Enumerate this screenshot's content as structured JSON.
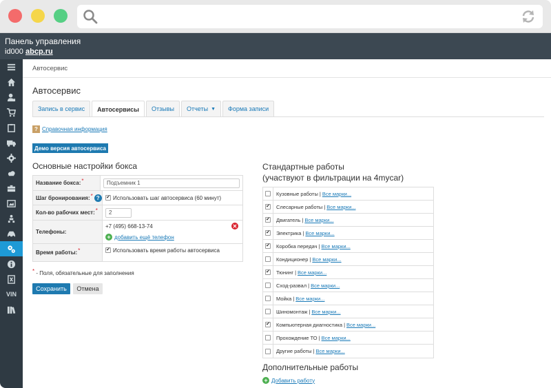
{
  "topbar": {
    "title": "Панель управления",
    "user_id": "id000",
    "site_link": "abcp.ru"
  },
  "sidebar": {
    "items": [
      {
        "icon": "menu-icon"
      },
      {
        "icon": "home-icon"
      },
      {
        "icon": "users-icon"
      },
      {
        "icon": "cart-icon"
      },
      {
        "icon": "clipboard-icon"
      },
      {
        "icon": "truck-icon"
      },
      {
        "icon": "gear-icon"
      },
      {
        "icon": "cloud-icon"
      },
      {
        "icon": "toolbox-icon"
      },
      {
        "icon": "image-icon"
      },
      {
        "icon": "person-tree-icon"
      },
      {
        "icon": "car-icon"
      },
      {
        "icon": "autoservice-icon",
        "active": true
      },
      {
        "icon": "info-icon"
      },
      {
        "icon": "excel-icon"
      },
      {
        "label": "VIN"
      },
      {
        "icon": "books-icon"
      }
    ],
    "active_color": "#1e9ad6"
  },
  "breadcrumb": "Автосервис",
  "page_title": "Автосервис",
  "tabs": [
    {
      "label": "Запись в сервис",
      "active": false
    },
    {
      "label": "Автосервисы",
      "active": true
    },
    {
      "label": "Отзывы",
      "active": false
    },
    {
      "label": "Отчеты",
      "active": false,
      "dropdown": true
    },
    {
      "label": "Форма записи",
      "active": false
    }
  ],
  "info_link": "Справочная информация",
  "demo_button": "Демо версия автосервиса",
  "settings": {
    "heading": "Основные настройки бокса",
    "box_name": {
      "label": "Название бокса:",
      "value": "Подъемник 1"
    },
    "booking_step": {
      "label": "Шаг бронирования:",
      "checkbox_label": "Использовать шаг автосервиса (60 минут)",
      "checked": true
    },
    "workplaces": {
      "label": "Кол-во рабочих мест:",
      "value": "2"
    },
    "phones": {
      "label": "Телефоны:",
      "value": "+7 (495) 668-13-74",
      "add_label": "добавить ещё телефон"
    },
    "work_time": {
      "label": "Время работы:",
      "checkbox_label": "Использовать время работы автосервиса",
      "checked": true
    },
    "required_note": "- Поля, обязательные для заполнения",
    "save_label": "Сохранить",
    "cancel_label": "Отмена"
  },
  "standard_works": {
    "heading_line1": "Стандартные работы",
    "heading_line2": "(участвуют в фильтрации на 4mycar)",
    "all_brands_label": "Все марки...",
    "items": [
      {
        "name": "Кузовные работы",
        "checked": false
      },
      {
        "name": "Слесарные работы",
        "checked": true
      },
      {
        "name": "Двигатель",
        "checked": true
      },
      {
        "name": "Электрика",
        "checked": true
      },
      {
        "name": "Коробка передач",
        "checked": true
      },
      {
        "name": "Кондиционер",
        "checked": false
      },
      {
        "name": "Тюнинг",
        "checked": true
      },
      {
        "name": "Сход-развал",
        "checked": false
      },
      {
        "name": "Мойка",
        "checked": false
      },
      {
        "name": "Шиномонтаж",
        "checked": false
      },
      {
        "name": "Компьютерная диагностика",
        "checked": true
      },
      {
        "name": "Прохождение ТО",
        "checked": false
      },
      {
        "name": "Другие работы",
        "checked": false
      }
    ]
  },
  "additional_works": {
    "heading": "Дополнительные работы",
    "add_label": "Добавить работу"
  }
}
